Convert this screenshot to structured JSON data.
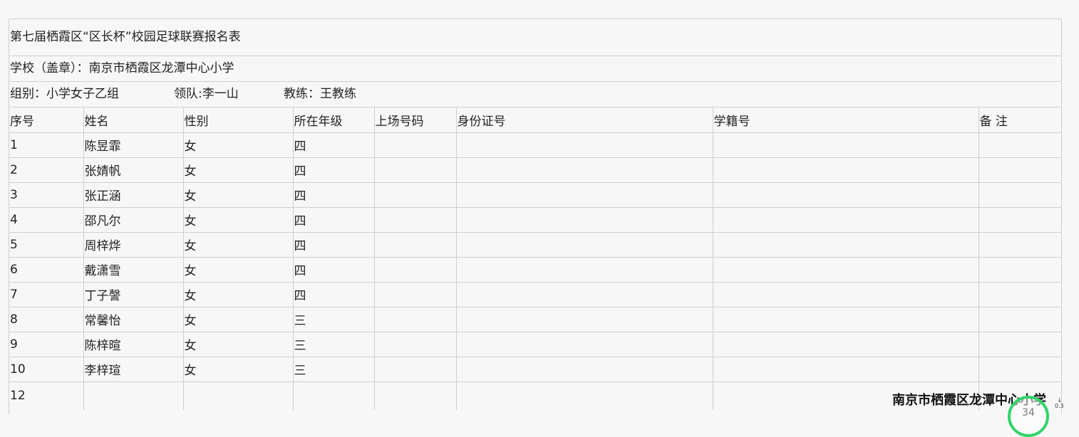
{
  "form": {
    "title": "第七届栖霞区“区长杯”校园足球联赛报名表",
    "school_line": "学校（盖章）：南京市栖霞区龙潭中心小学",
    "group": "组别：小学女子乙组",
    "leader": "领队:李一山",
    "coach": "教练：王教练"
  },
  "table": {
    "headers": [
      "序号",
      "姓名",
      "性别",
      "所在年级",
      "上场号码",
      "身份证号",
      "学籍号",
      "备  注"
    ],
    "rows": [
      [
        "1",
        "陈昱霏",
        "女",
        "四",
        "",
        "",
        "",
        ""
      ],
      [
        "2",
        "张婧帆",
        "女",
        "四",
        "",
        "",
        "",
        ""
      ],
      [
        "3",
        "张正涵",
        "女",
        "四",
        "",
        "",
        "",
        ""
      ],
      [
        "4",
        "邵凡尔",
        "女",
        "四",
        "",
        "",
        "",
        ""
      ],
      [
        "5",
        "周梓烨",
        "女",
        "四",
        "",
        "",
        "",
        ""
      ],
      [
        "6",
        "戴潇雪",
        "女",
        "四",
        "",
        "",
        "",
        ""
      ],
      [
        "7",
        "丁子謦",
        "女",
        "四",
        "",
        "",
        "",
        ""
      ],
      [
        "8",
        "常馨怡",
        "女",
        "三",
        "",
        "",
        "",
        ""
      ],
      [
        "9",
        "陈梓暄",
        "女",
        "三",
        "",
        "",
        "",
        ""
      ],
      [
        "10",
        "李梓瑄",
        "女",
        "三",
        "",
        "",
        "",
        ""
      ],
      [
        "12",
        "",
        "",
        "",
        "",
        "",
        "",
        ""
      ]
    ]
  },
  "footer": {
    "school_stamp": "南京市栖霞区龙潭中心小学"
  },
  "overlay": {
    "speed_value": "34",
    "speed_side": "0.3",
    "ring_color": "#32d46b"
  }
}
